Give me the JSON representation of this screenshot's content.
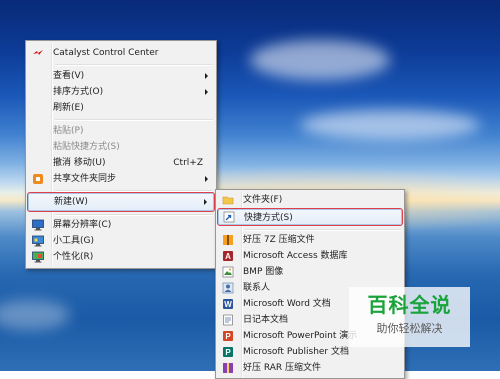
{
  "context_menu": {
    "items": [
      {
        "label": "Catalyst Control Center"
      },
      {
        "label": "查看(V)"
      },
      {
        "label": "排序方式(O)"
      },
      {
        "label": "刷新(E)"
      },
      {
        "label": "粘贴(P)"
      },
      {
        "label": "粘贴快捷方式(S)"
      },
      {
        "label": "撤消 移动(U)",
        "shortcut": "Ctrl+Z"
      },
      {
        "label": "共享文件夹同步"
      },
      {
        "label": "新建(W)"
      },
      {
        "label": "屏幕分辨率(C)"
      },
      {
        "label": "小工具(G)"
      },
      {
        "label": "个性化(R)"
      }
    ]
  },
  "new_submenu": {
    "items": [
      {
        "label": "文件夹(F)",
        "icon": "folder-icon"
      },
      {
        "label": "快捷方式(S)",
        "icon": "shortcut-icon"
      },
      {
        "label": "好压 7Z 压缩文件",
        "icon": "archive-icon"
      },
      {
        "label": "Microsoft Access 数据库",
        "icon": "access-icon"
      },
      {
        "label": "BMP 图像",
        "icon": "bitmap-icon"
      },
      {
        "label": "联系人",
        "icon": "contact-icon"
      },
      {
        "label": "Microsoft Word 文档",
        "icon": "word-icon"
      },
      {
        "label": "日记本文档",
        "icon": "journal-icon"
      },
      {
        "label": "Microsoft PowerPoint 演示",
        "icon": "powerpoint-icon"
      },
      {
        "label": "Microsoft Publisher 文档",
        "icon": "publisher-icon"
      },
      {
        "label": "好压 RAR 压缩文件",
        "icon": "archive-icon"
      }
    ]
  },
  "watermark": {
    "title": "百科全说",
    "subtitle": "助你轻松解决"
  },
  "colors": {
    "highlight_box": "#e0404a",
    "hover_fill": "#e4edf8",
    "watermark_green": "#1aa33a"
  }
}
